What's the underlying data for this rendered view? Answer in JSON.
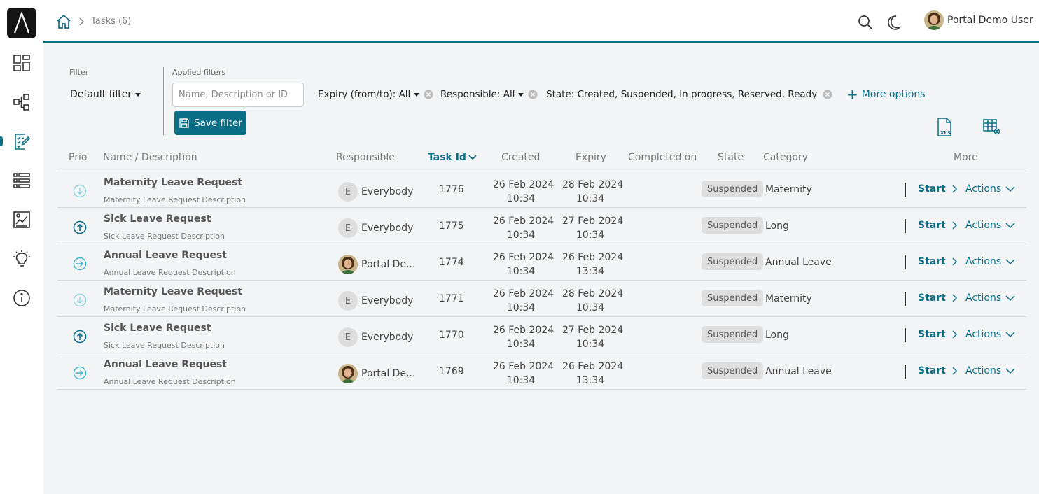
{
  "header": {
    "breadcrumb": "Tasks (6)",
    "user_name": "Portal Demo User"
  },
  "sidebar": {
    "items": [
      {
        "icon": "dashboard-icon"
      },
      {
        "icon": "process-icon"
      },
      {
        "icon": "tasks-icon",
        "active": true
      },
      {
        "icon": "list-icon"
      },
      {
        "icon": "statistics-icon"
      },
      {
        "icon": "idea-icon"
      },
      {
        "icon": "info-icon"
      }
    ]
  },
  "filter": {
    "label": "Filter",
    "selected": "Default filter",
    "applied_label": "Applied filters",
    "search_placeholder": "Name, Description or ID",
    "chips": {
      "expiry": "Expiry (from/to): All",
      "responsible": "Responsible: All",
      "state": "State: Created, Suspended, In progress, Reserved, Ready for jo"
    },
    "more_options": "More options",
    "save_label": "Save filter"
  },
  "table": {
    "columns": {
      "prio": "Prio",
      "name": "Name / Description",
      "responsible": "Responsible",
      "task_id": "Task Id",
      "created": "Created",
      "expiry": "Expiry",
      "completed": "Completed on",
      "state": "State",
      "category": "Category",
      "more": "More"
    },
    "rows": [
      {
        "prio": "low",
        "name": "Maternity Leave Request",
        "desc": "Maternity Leave Request Description",
        "responsible": "Everybody",
        "resp_type": "group",
        "id": "1776",
        "created_date": "26 Feb 2024",
        "created_time": "10:34",
        "expiry_date": "28 Feb 2024",
        "expiry_time": "10:34",
        "state": "Suspended",
        "category": "Maternity",
        "start": "Start",
        "actions": "Actions"
      },
      {
        "prio": "high",
        "name": "Sick Leave Request",
        "desc": "Sick Leave Request Description",
        "responsible": "Everybody",
        "resp_type": "group",
        "id": "1775",
        "created_date": "26 Feb 2024",
        "created_time": "10:34",
        "expiry_date": "27 Feb 2024",
        "expiry_time": "10:34",
        "state": "Suspended",
        "category": "Long",
        "start": "Start",
        "actions": "Actions"
      },
      {
        "prio": "normal",
        "name": "Annual Leave Request",
        "desc": "Annual Leave Request Description",
        "responsible": "Portal De...",
        "resp_type": "user",
        "id": "1774",
        "created_date": "26 Feb 2024",
        "created_time": "10:34",
        "expiry_date": "26 Feb 2024",
        "expiry_time": "13:34",
        "state": "Suspended",
        "category": "Annual Leave",
        "start": "Start",
        "actions": "Actions"
      },
      {
        "prio": "low",
        "name": "Maternity Leave Request",
        "desc": "Maternity Leave Request Description",
        "responsible": "Everybody",
        "resp_type": "group",
        "id": "1771",
        "created_date": "26 Feb 2024",
        "created_time": "10:34",
        "expiry_date": "28 Feb 2024",
        "expiry_time": "10:34",
        "state": "Suspended",
        "category": "Maternity",
        "start": "Start",
        "actions": "Actions"
      },
      {
        "prio": "high",
        "name": "Sick Leave Request",
        "desc": "Sick Leave Request Description",
        "responsible": "Everybody",
        "resp_type": "group",
        "id": "1770",
        "created_date": "26 Feb 2024",
        "created_time": "10:34",
        "expiry_date": "27 Feb 2024",
        "expiry_time": "10:34",
        "state": "Suspended",
        "category": "Long",
        "start": "Start",
        "actions": "Actions"
      },
      {
        "prio": "normal",
        "name": "Annual Leave Request",
        "desc": "Annual Leave Request Description",
        "responsible": "Portal De...",
        "resp_type": "user",
        "id": "1769",
        "created_date": "26 Feb 2024",
        "created_time": "10:34",
        "expiry_date": "26 Feb 2024",
        "expiry_time": "13:34",
        "state": "Suspended",
        "category": "Annual Leave",
        "start": "Start",
        "actions": "Actions"
      }
    ]
  },
  "colors": {
    "accent": "#0b6e87",
    "prio_low": "#8fd3e0",
    "prio_high": "#0b6e87",
    "prio_normal": "#3fb6cc"
  }
}
